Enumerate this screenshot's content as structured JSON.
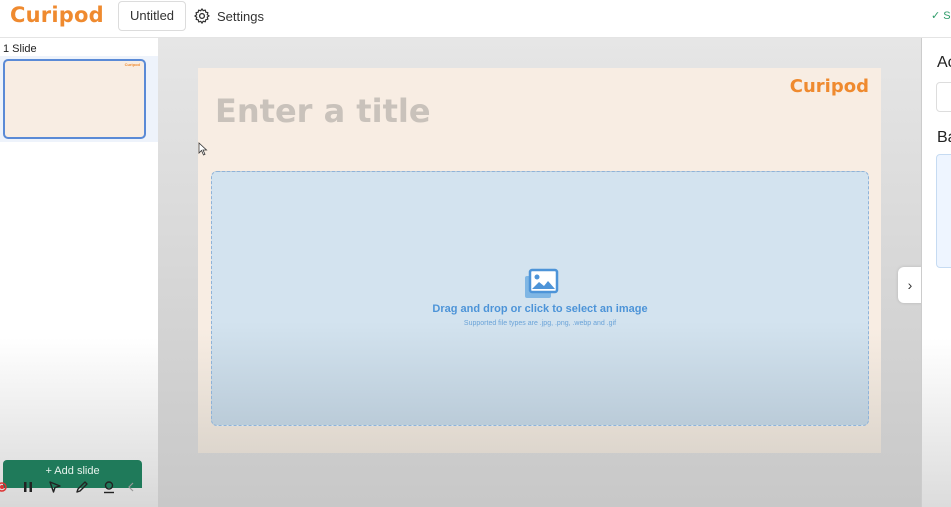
{
  "app": {
    "logo_text": "Curipod",
    "document_title": "Untitled",
    "settings_label": "Settings",
    "save_status": "S",
    "brand_color": "#ef8a2f"
  },
  "sidebar": {
    "slides_count_label": "1 Slide",
    "thumbnail_logo": "Curipod",
    "add_slide_label": "+ Add slide"
  },
  "toolbar": {
    "icons": [
      "record-icon",
      "pause-icon",
      "pointer-icon",
      "pen-icon",
      "webcam-icon",
      "chevron-left-icon"
    ]
  },
  "slide": {
    "logo_text": "Curipod",
    "title_placeholder": "Enter a title",
    "dropzone_label": "Drag and drop or click to select an image",
    "dropzone_hint": "Supported file types are .jpg, .png, .webp and .gif"
  },
  "right_panel": {
    "heading_1": "Ac",
    "heading_2": "Ba"
  }
}
